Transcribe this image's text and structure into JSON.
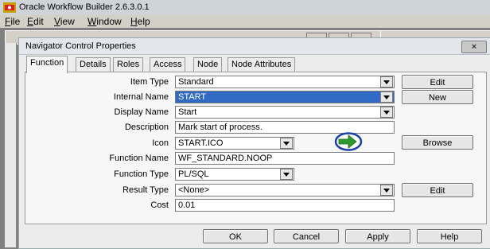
{
  "app": {
    "title": "Oracle Workflow Builder 2.6.3.0.1",
    "menu": [
      {
        "pre": "",
        "key": "F",
        "post": "ile"
      },
      {
        "pre": "",
        "key": "E",
        "post": "dit"
      },
      {
        "pre": "",
        "key": "V",
        "post": "iew"
      },
      {
        "pre": "",
        "key": "W",
        "post": "indow"
      },
      {
        "pre": "",
        "key": "H",
        "post": "elp"
      }
    ]
  },
  "dialog": {
    "title": "Navigator Control Properties",
    "close_label": "×",
    "tabs": [
      "Function",
      "Details",
      "Roles",
      "Access",
      "Node",
      "Node Attributes"
    ],
    "fields": {
      "item_type": {
        "label": "Item Type",
        "value": "Standard"
      },
      "internal_name": {
        "label": "Internal Name",
        "value": "START"
      },
      "display_name": {
        "label": "Display Name",
        "value": "Start"
      },
      "description": {
        "label": "Description",
        "value": "Mark start of process."
      },
      "icon": {
        "label": "Icon",
        "value": "START.ICO"
      },
      "function_name": {
        "label": "Function Name",
        "value": "WF_STANDARD.NOOP"
      },
      "function_type": {
        "label": "Function Type",
        "value": "PL/SQL"
      },
      "result_type": {
        "label": "Result Type",
        "value": "<None>"
      },
      "cost": {
        "label": "Cost",
        "value": "0.01"
      }
    },
    "side_buttons": {
      "edit_item_type": "Edit",
      "new": "New",
      "browse": "Browse",
      "edit_result_type": "Edit"
    },
    "footer": {
      "ok": "OK",
      "cancel": "Cancel",
      "apply": "Apply",
      "help": "Help"
    }
  },
  "colors": {
    "selection": "#316ac5",
    "icon_green": "#2e9a2e",
    "icon_ring": "#1a3fa8"
  }
}
